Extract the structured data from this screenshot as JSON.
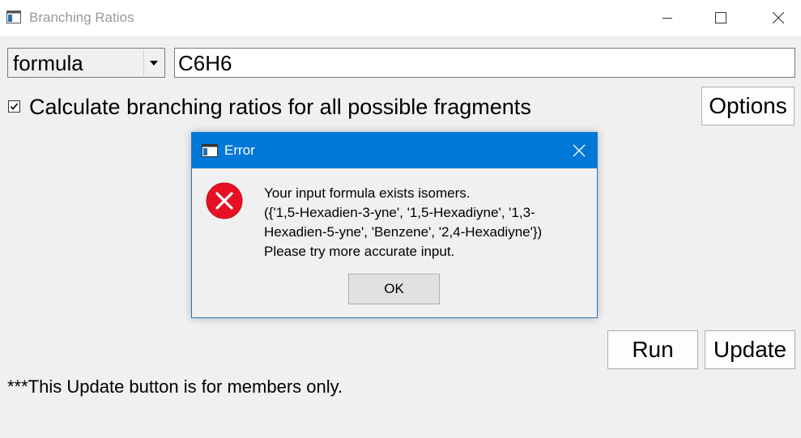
{
  "window": {
    "title": "Branching Ratios",
    "icon": "app-window-icon",
    "controls": [
      "minimize-icon",
      "maximize-icon",
      "close-icon"
    ]
  },
  "form": {
    "search_type": "formula",
    "formula_value": "C6H6",
    "checkbox_checked": true,
    "checkbox_label": "Calculate branching ratios for all possible fragments",
    "options_label": "Options",
    "run_label": "Run",
    "update_label": "Update",
    "note": "***This Update button is for members only."
  },
  "dialog": {
    "title": "Error",
    "icon": "error-icon",
    "message_lines": [
      "Your input formula exists isomers.",
      "({'1,5-Hexadien-3-yne', '1,5-Hexadiyne', '1,3-",
      "Hexadien-5-yne', 'Benzene', '2,4-Hexadiyne'})",
      "Please try more accurate input."
    ],
    "ok_label": "OK"
  },
  "colors": {
    "dialog_titlebar": "#0078d7",
    "error_red": "#e81123",
    "window_bg": "#f0f0f0"
  }
}
